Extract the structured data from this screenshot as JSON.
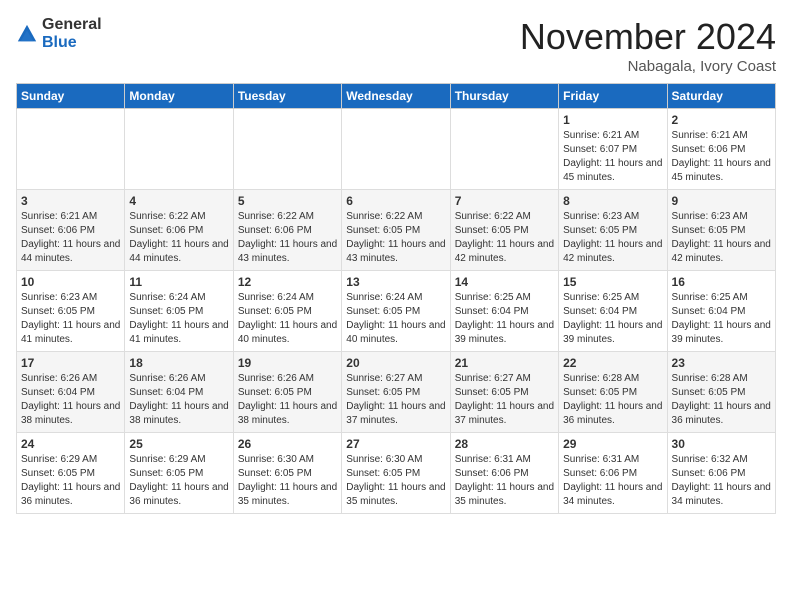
{
  "logo": {
    "general": "General",
    "blue": "Blue"
  },
  "title": "November 2024",
  "location": "Nabagala, Ivory Coast",
  "days_of_week": [
    "Sunday",
    "Monday",
    "Tuesday",
    "Wednesday",
    "Thursday",
    "Friday",
    "Saturday"
  ],
  "weeks": [
    [
      {
        "day": "",
        "content": ""
      },
      {
        "day": "",
        "content": ""
      },
      {
        "day": "",
        "content": ""
      },
      {
        "day": "",
        "content": ""
      },
      {
        "day": "",
        "content": ""
      },
      {
        "day": "1",
        "content": "Sunrise: 6:21 AM\nSunset: 6:07 PM\nDaylight: 11 hours and 45 minutes."
      },
      {
        "day": "2",
        "content": "Sunrise: 6:21 AM\nSunset: 6:06 PM\nDaylight: 11 hours and 45 minutes."
      }
    ],
    [
      {
        "day": "3",
        "content": "Sunrise: 6:21 AM\nSunset: 6:06 PM\nDaylight: 11 hours and 44 minutes."
      },
      {
        "day": "4",
        "content": "Sunrise: 6:22 AM\nSunset: 6:06 PM\nDaylight: 11 hours and 44 minutes."
      },
      {
        "day": "5",
        "content": "Sunrise: 6:22 AM\nSunset: 6:06 PM\nDaylight: 11 hours and 43 minutes."
      },
      {
        "day": "6",
        "content": "Sunrise: 6:22 AM\nSunset: 6:05 PM\nDaylight: 11 hours and 43 minutes."
      },
      {
        "day": "7",
        "content": "Sunrise: 6:22 AM\nSunset: 6:05 PM\nDaylight: 11 hours and 42 minutes."
      },
      {
        "day": "8",
        "content": "Sunrise: 6:23 AM\nSunset: 6:05 PM\nDaylight: 11 hours and 42 minutes."
      },
      {
        "day": "9",
        "content": "Sunrise: 6:23 AM\nSunset: 6:05 PM\nDaylight: 11 hours and 42 minutes."
      }
    ],
    [
      {
        "day": "10",
        "content": "Sunrise: 6:23 AM\nSunset: 6:05 PM\nDaylight: 11 hours and 41 minutes."
      },
      {
        "day": "11",
        "content": "Sunrise: 6:24 AM\nSunset: 6:05 PM\nDaylight: 11 hours and 41 minutes."
      },
      {
        "day": "12",
        "content": "Sunrise: 6:24 AM\nSunset: 6:05 PM\nDaylight: 11 hours and 40 minutes."
      },
      {
        "day": "13",
        "content": "Sunrise: 6:24 AM\nSunset: 6:05 PM\nDaylight: 11 hours and 40 minutes."
      },
      {
        "day": "14",
        "content": "Sunrise: 6:25 AM\nSunset: 6:04 PM\nDaylight: 11 hours and 39 minutes."
      },
      {
        "day": "15",
        "content": "Sunrise: 6:25 AM\nSunset: 6:04 PM\nDaylight: 11 hours and 39 minutes."
      },
      {
        "day": "16",
        "content": "Sunrise: 6:25 AM\nSunset: 6:04 PM\nDaylight: 11 hours and 39 minutes."
      }
    ],
    [
      {
        "day": "17",
        "content": "Sunrise: 6:26 AM\nSunset: 6:04 PM\nDaylight: 11 hours and 38 minutes."
      },
      {
        "day": "18",
        "content": "Sunrise: 6:26 AM\nSunset: 6:04 PM\nDaylight: 11 hours and 38 minutes."
      },
      {
        "day": "19",
        "content": "Sunrise: 6:26 AM\nSunset: 6:05 PM\nDaylight: 11 hours and 38 minutes."
      },
      {
        "day": "20",
        "content": "Sunrise: 6:27 AM\nSunset: 6:05 PM\nDaylight: 11 hours and 37 minutes."
      },
      {
        "day": "21",
        "content": "Sunrise: 6:27 AM\nSunset: 6:05 PM\nDaylight: 11 hours and 37 minutes."
      },
      {
        "day": "22",
        "content": "Sunrise: 6:28 AM\nSunset: 6:05 PM\nDaylight: 11 hours and 36 minutes."
      },
      {
        "day": "23",
        "content": "Sunrise: 6:28 AM\nSunset: 6:05 PM\nDaylight: 11 hours and 36 minutes."
      }
    ],
    [
      {
        "day": "24",
        "content": "Sunrise: 6:29 AM\nSunset: 6:05 PM\nDaylight: 11 hours and 36 minutes."
      },
      {
        "day": "25",
        "content": "Sunrise: 6:29 AM\nSunset: 6:05 PM\nDaylight: 11 hours and 36 minutes."
      },
      {
        "day": "26",
        "content": "Sunrise: 6:30 AM\nSunset: 6:05 PM\nDaylight: 11 hours and 35 minutes."
      },
      {
        "day": "27",
        "content": "Sunrise: 6:30 AM\nSunset: 6:05 PM\nDaylight: 11 hours and 35 minutes."
      },
      {
        "day": "28",
        "content": "Sunrise: 6:31 AM\nSunset: 6:06 PM\nDaylight: 11 hours and 35 minutes."
      },
      {
        "day": "29",
        "content": "Sunrise: 6:31 AM\nSunset: 6:06 PM\nDaylight: 11 hours and 34 minutes."
      },
      {
        "day": "30",
        "content": "Sunrise: 6:32 AM\nSunset: 6:06 PM\nDaylight: 11 hours and 34 minutes."
      }
    ]
  ]
}
